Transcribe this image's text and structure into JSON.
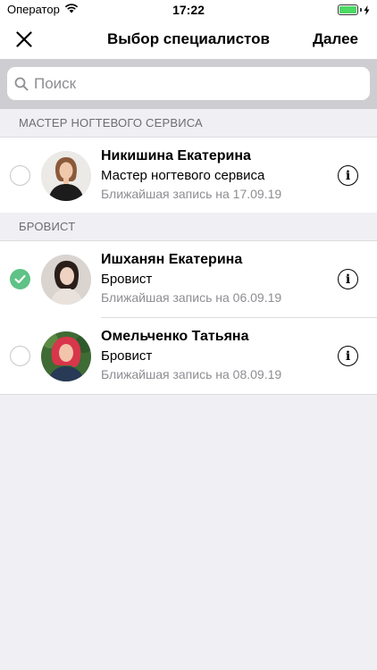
{
  "status_bar": {
    "carrier": "Оператор",
    "time": "17:22",
    "battery_level": 1.0
  },
  "navbar": {
    "title": "Выбор специалистов",
    "next_label": "Далее",
    "close_icon": "close-icon"
  },
  "search": {
    "placeholder": "Поиск",
    "value": ""
  },
  "sections": [
    {
      "header": "МАСТЕР НОГТЕВОГО СЕРВИСА",
      "specialists": [
        {
          "name": "Никишина Екатерина",
          "role": "Мастер ногтевого сервиса",
          "next_appointment": "Ближайшая запись на 17.09.19",
          "selected": false
        }
      ]
    },
    {
      "header": "БРОВИСТ",
      "specialists": [
        {
          "name": "Ишханян Екатерина",
          "role": "Бровист",
          "next_appointment": "Ближайшая запись на 06.09.19",
          "selected": true
        },
        {
          "name": "Омельченко Татьяна",
          "role": "Бровист",
          "next_appointment": "Ближайшая запись на 08.09.19",
          "selected": false
        }
      ]
    }
  ],
  "colors": {
    "accent_check": "#5fc286",
    "group_background": "#efeff4",
    "secondary_text": "#8e8e93"
  }
}
